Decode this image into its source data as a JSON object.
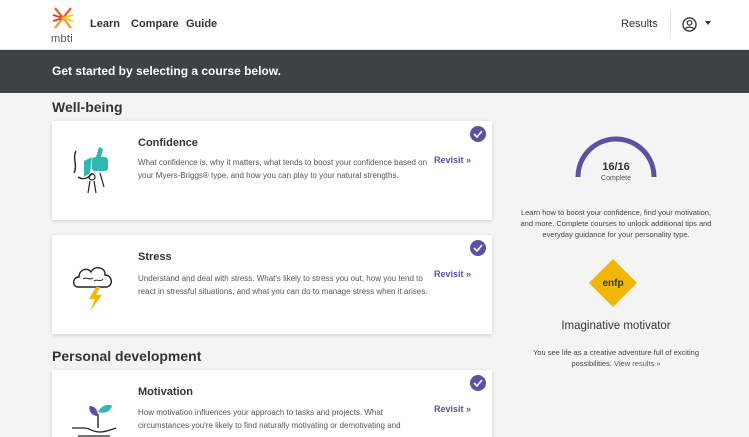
{
  "nav": {
    "logo_text": "mbti",
    "links": [
      "Learn",
      "Compare",
      "Guide"
    ],
    "results": "Results",
    "icons": {
      "user": "user-circle-icon",
      "caret": "caret-down-icon"
    }
  },
  "banner": {
    "text": "Get started by selecting a course below."
  },
  "sections": [
    {
      "title": "Well-being",
      "courses": [
        {
          "title": "Confidence",
          "description": "What confidence is, why it matters, what tends to boost your confidence based on your Myers-Briggs® type, and how you can play to your natural strengths.",
          "action": "Revisit »",
          "completed": true,
          "icon": "thumbs-up-icon"
        },
        {
          "title": "Stress",
          "description": "Understand and deal with stress. What's likely to stress you out, how you tend to react in stressful situations, and what you can do to manage stress when it arises.",
          "action": "Revisit »",
          "completed": true,
          "icon": "storm-cloud-icon"
        }
      ]
    },
    {
      "title": "Personal development",
      "courses": [
        {
          "title": "Motivation",
          "description": "How motivation influences your approach to tasks and projects. What circumstances you're likely to find naturally motivating or demotivating and",
          "action": "Revisit »",
          "completed": true,
          "icon": "sprout-hand-icon"
        }
      ]
    }
  ],
  "sidebar": {
    "progress": {
      "count": "16/16",
      "label": "Complete",
      "fraction": 1.0
    },
    "info": "Learn how to boost your confidence, find your motivation, and more. Complete courses to unlock additional tips and everyday guidance for your personality type.",
    "type_code": "enfp",
    "type_name": "Imaginative motivator",
    "type_desc": "You see life as a creative adventure full of exciting possibilities.",
    "view_results": "View results »"
  },
  "colors": {
    "accent": "#5e4fa3",
    "banner": "#3c4245",
    "type_badge": "#f2b705"
  }
}
